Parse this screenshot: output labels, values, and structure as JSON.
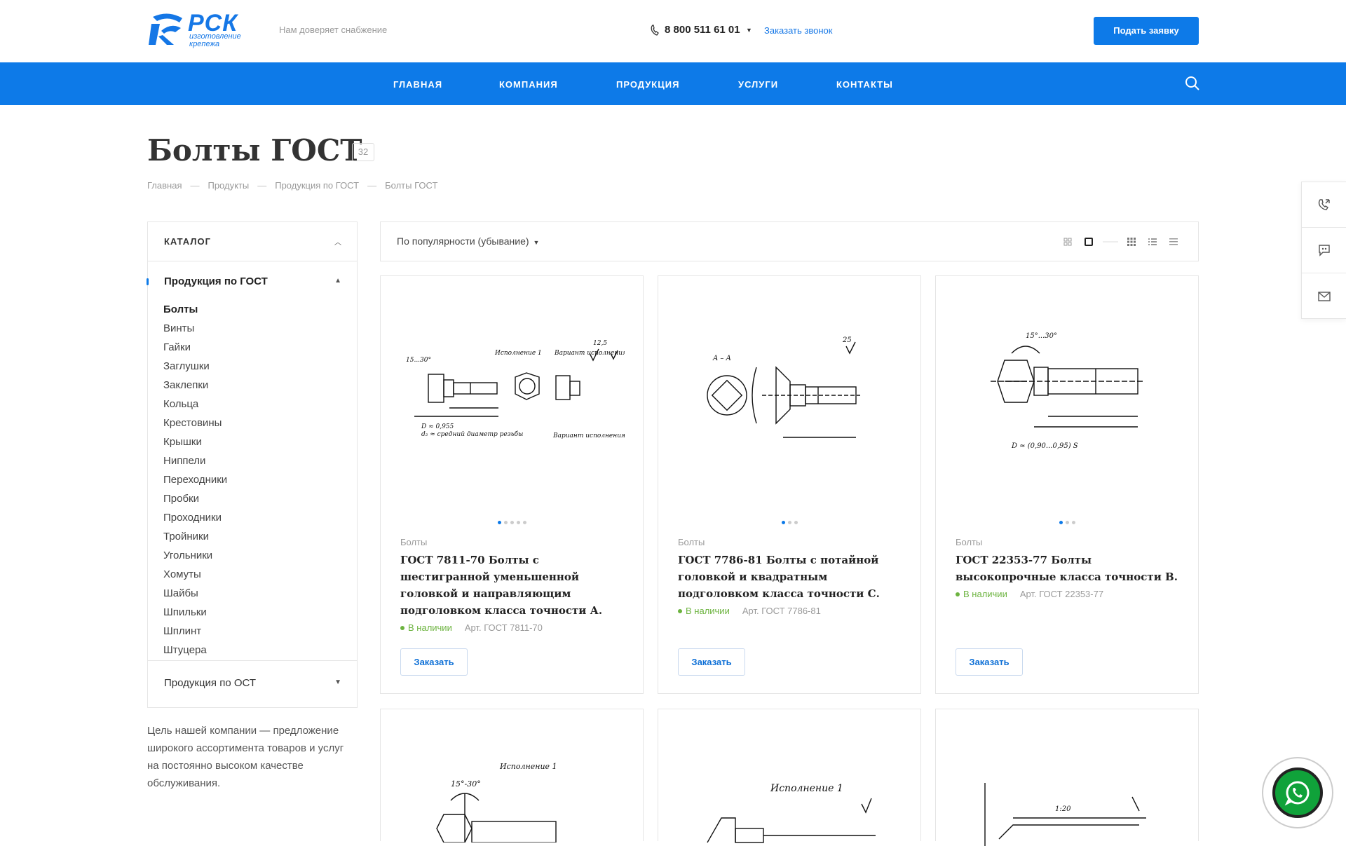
{
  "header": {
    "logo_brand": "РСК",
    "logo_sub_1": "изготовление",
    "logo_sub_2": "крепежа",
    "tagline": "Нам доверяет снабжение",
    "phone": "8 800 511 61 01",
    "callback": "Заказать звонок",
    "apply_button": "Подать заявку"
  },
  "nav": {
    "items": [
      "ГЛАВНАЯ",
      "КОМПАНИЯ",
      "ПРОДУКЦИЯ",
      "УСЛУГИ",
      "КОНТАКТЫ"
    ]
  },
  "page": {
    "title": "Болты ГОСТ",
    "count": "32",
    "breadcrumb": [
      "Главная",
      "Продукты",
      "Продукция по ГОСТ",
      "Болты ГОСТ"
    ],
    "breadcrumb_sep": "—"
  },
  "sidebar": {
    "catalog_title": "КАТАЛОГ",
    "group_active": "Продукция по ГОСТ",
    "items": [
      "Болты",
      "Винты",
      "Гайки",
      "Заглушки",
      "Заклепки",
      "Кольца",
      "Крестовины",
      "Крышки",
      "Ниппели",
      "Переходники",
      "Пробки",
      "Проходники",
      "Тройники",
      "Угольники",
      "Хомуты",
      "Шайбы",
      "Шпильки",
      "Шплинт",
      "Штуцера"
    ],
    "group_other": "Продукция по ОСТ",
    "about": "Цель нашей компании — предложение широкого ассортимента товаров и услуг на постоянно высоком качестве обслуживания."
  },
  "toolbar": {
    "sort": "По популярности (убывание)"
  },
  "products": [
    {
      "category": "Болты",
      "title": "ГОСТ 7811-70 Болты с шестигранной уменьшенной головкой и направляющим подголовком класса точности А.",
      "stock": "В наличии",
      "article": "Арт. ГОСТ 7811-70",
      "order": "Заказать",
      "dot_count": 5,
      "drawing_labels": [
        "Исполнение 1",
        "Вариант исполнения головки",
        "Вариант исполнения",
        "D ≈ 0,955",
        "d₂ ≈ средний диаметр резьбы",
        "15...30°",
        "12,5"
      ]
    },
    {
      "category": "Болты",
      "title": "ГОСТ 7786-81 Болты с потайной головкой и квадратным подголовком класса точности С.",
      "stock": "В наличии",
      "article": "Арт. ГОСТ 7786-81",
      "order": "Заказать",
      "dot_count": 3,
      "drawing_labels": [
        "A – A",
        "25"
      ]
    },
    {
      "category": "Болты",
      "title": "ГОСТ 22353-77 Болты высокопрочные класса точности В.",
      "stock": "В наличии",
      "article": "Арт. ГОСТ 22353-77",
      "order": "Заказать",
      "dot_count": 3,
      "drawing_labels": [
        "15°...30°",
        "D ≈ (0,90...0,95) S"
      ]
    }
  ],
  "next_row_labels": [
    "Исполнение 1",
    "15°-30°",
    "Исполнение 1",
    "1:20"
  ],
  "colors": {
    "brand_blue": "#0d7ae8",
    "stock_green": "#6cb33f",
    "whatsapp_green": "#10a23a"
  }
}
